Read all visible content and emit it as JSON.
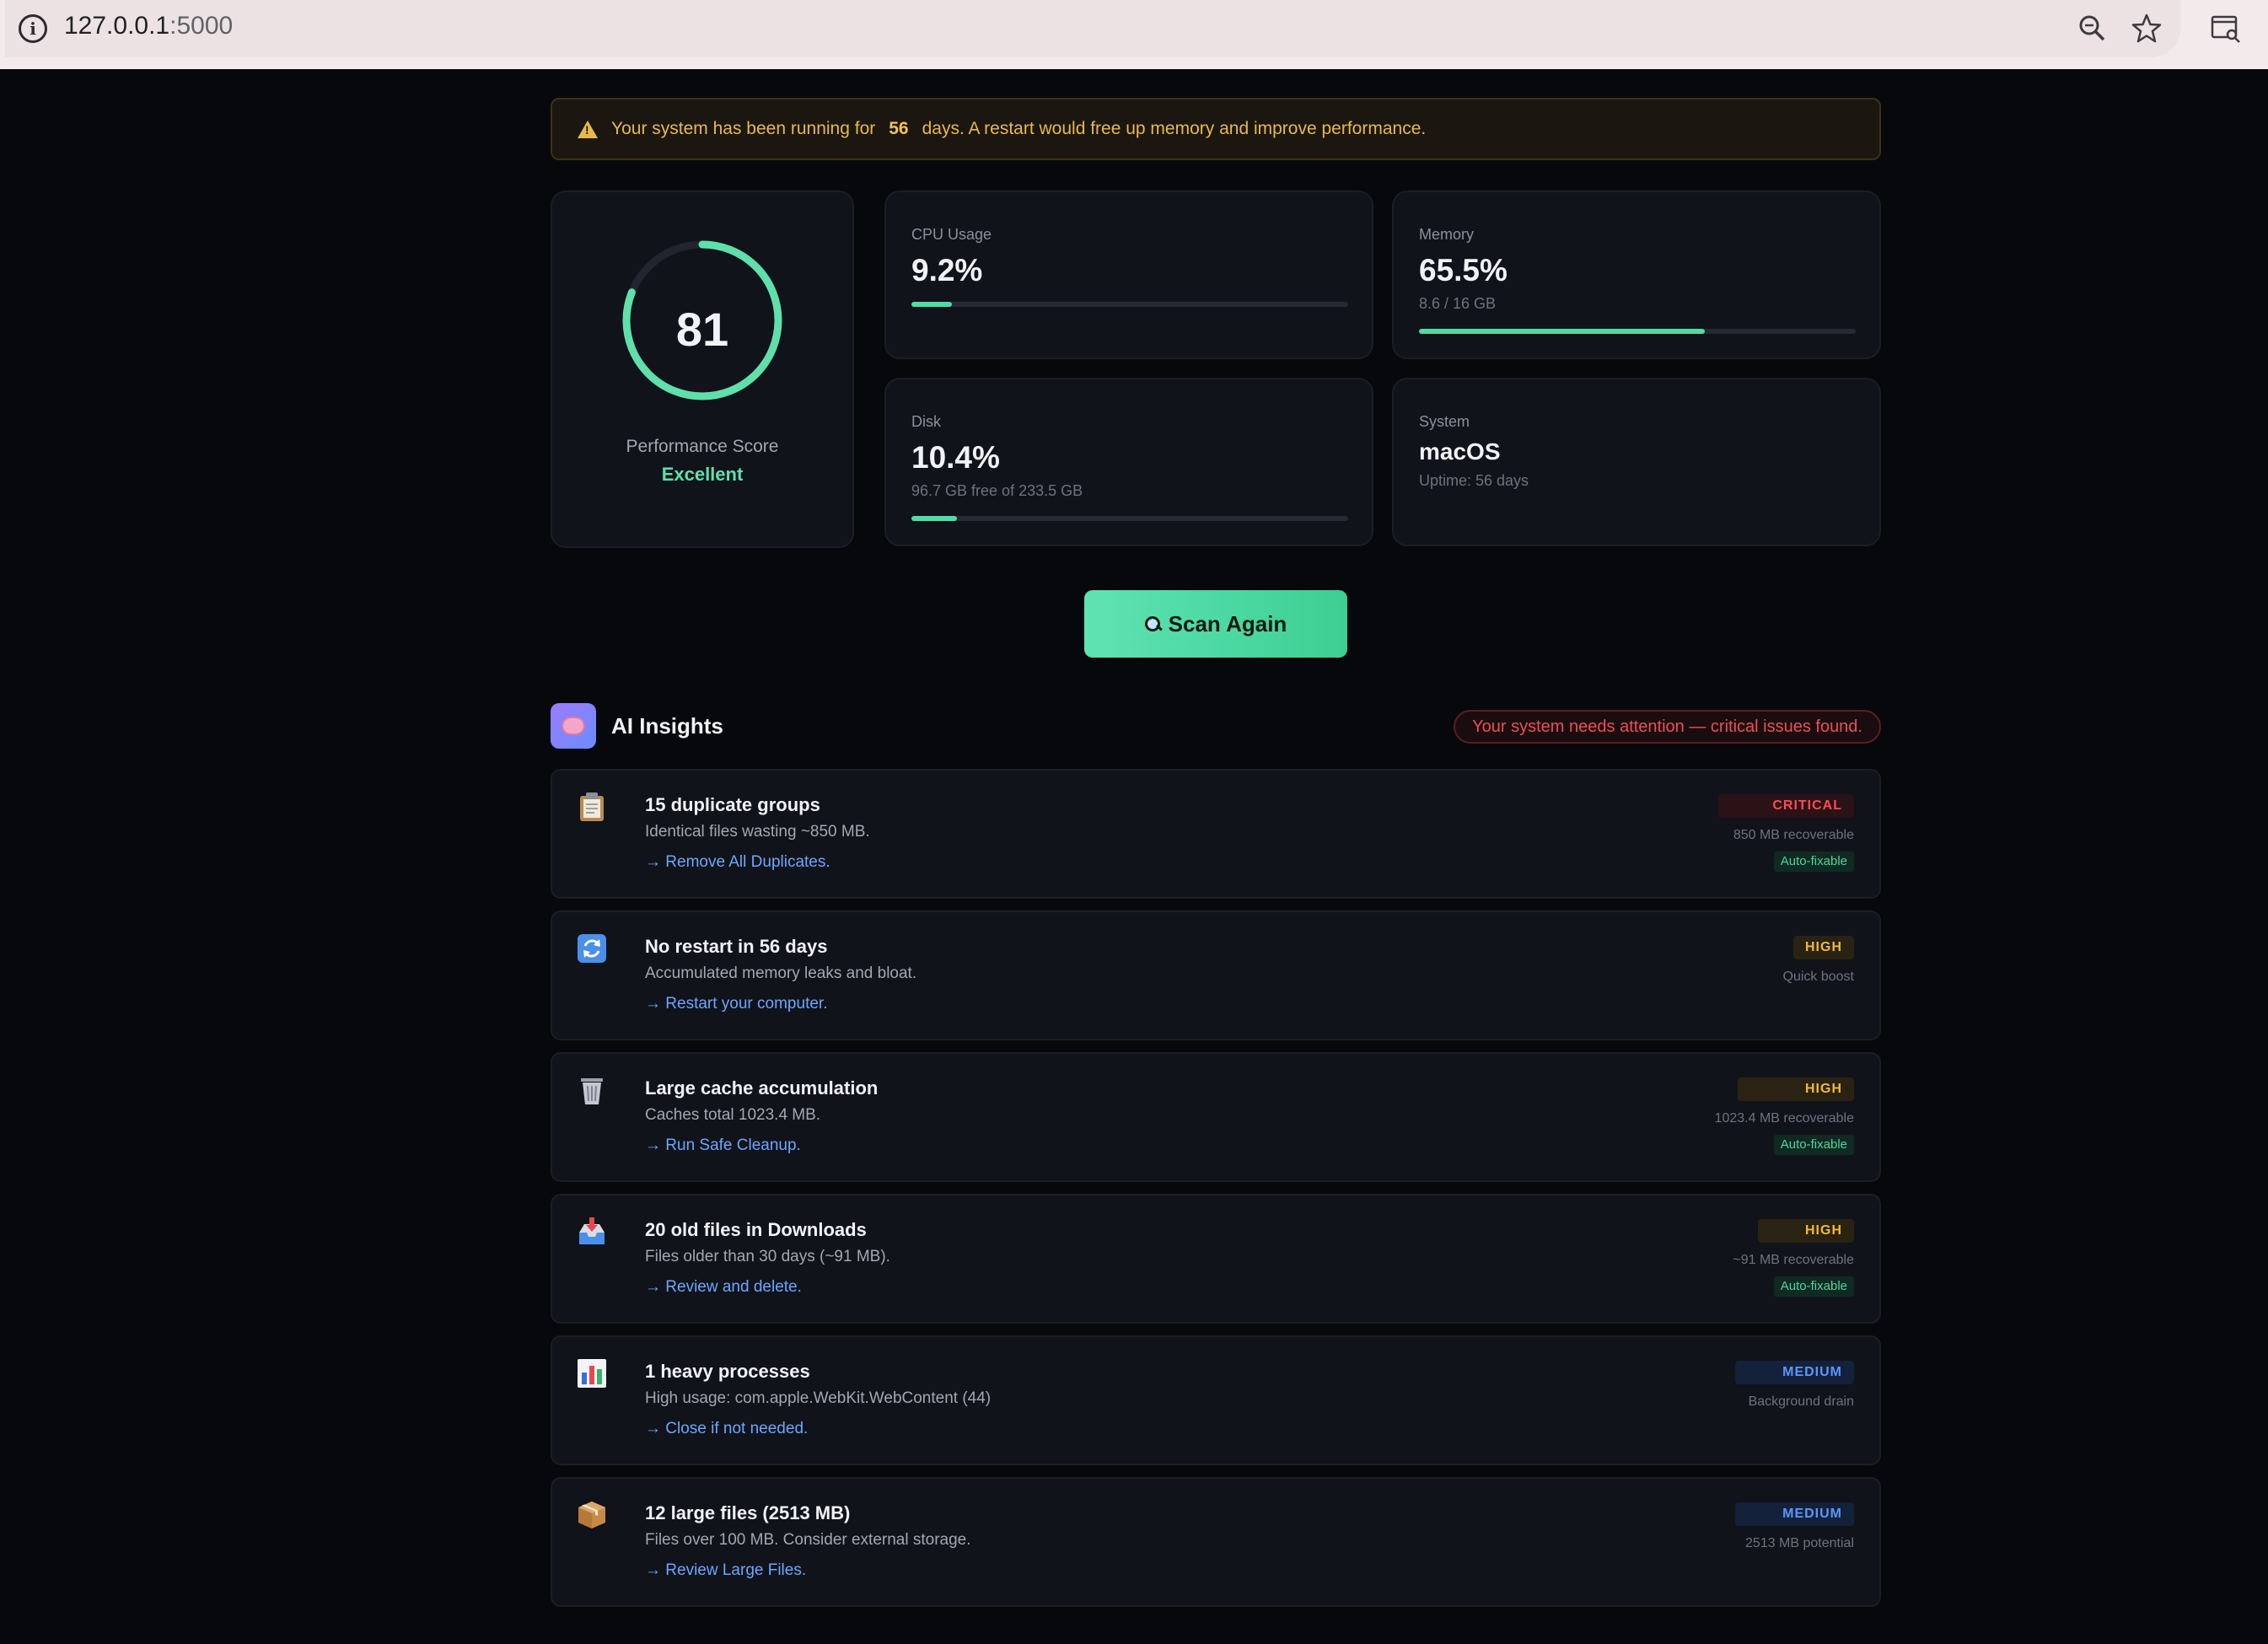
{
  "browser": {
    "url_host": "127.0.0.1",
    "url_port": ":5000"
  },
  "banner": {
    "text_before": "Your system has been running for",
    "days": "56",
    "text_after": "days. A restart would free up memory and improve performance."
  },
  "score": {
    "value": "81",
    "fraction": 0.81,
    "label": "Performance Score",
    "status": "Excellent"
  },
  "cpu": {
    "label": "CPU Usage",
    "value": "9.2%",
    "percent": 9.2
  },
  "memory": {
    "label": "Memory",
    "value": "65.5%",
    "sub": "8.6 / 16 GB",
    "percent": 65.5
  },
  "disk": {
    "label": "Disk",
    "value": "10.4%",
    "sub": "96.7 GB free of 233.5 GB",
    "percent": 10.4
  },
  "system": {
    "label": "System",
    "value": "macOS",
    "sub": "Uptime: 56 days"
  },
  "scan_button": {
    "label": "Scan Again"
  },
  "insights": {
    "title": "AI Insights",
    "attention": "Your system needs attention — critical issues found.",
    "items": [
      {
        "icon": "clipboard-icon",
        "title": "15 duplicate groups",
        "desc": "Identical files wasting ~850 MB.",
        "action": "→ Remove All Duplicates.",
        "severity": "CRITICAL",
        "meta": "850 MB recoverable",
        "auto": "Auto-fixable"
      },
      {
        "icon": "restart-icon",
        "title": "No restart in 56 days",
        "desc": "Accumulated memory leaks and bloat.",
        "action": "→ Restart your computer.",
        "severity": "HIGH",
        "meta": "Quick boost",
        "auto": ""
      },
      {
        "icon": "trash-icon",
        "title": "Large cache accumulation",
        "desc": "Caches total 1023.4 MB.",
        "action": "→ Run Safe Cleanup.",
        "severity": "HIGH",
        "meta": "1023.4 MB recoverable",
        "auto": "Auto-fixable"
      },
      {
        "icon": "inbox-icon",
        "title": "20 old files in Downloads",
        "desc": "Files older than 30 days (~91 MB).",
        "action": "→ Review and delete.",
        "severity": "HIGH",
        "meta": "~91 MB recoverable",
        "auto": "Auto-fixable"
      },
      {
        "icon": "bar-chart-icon",
        "title": "1 heavy processes",
        "desc": "High usage: com.apple.WebKit.WebContent (44)",
        "action": "→ Close if not needed.",
        "severity": "MEDIUM",
        "meta": "Background drain",
        "auto": ""
      },
      {
        "icon": "package-icon",
        "title": "12 large files (2513 MB)",
        "desc": "Files over 100 MB. Consider external storage.",
        "action": "→ Review Large Files.",
        "severity": "MEDIUM",
        "meta": "2513 MB potential",
        "auto": ""
      }
    ]
  },
  "colors": {
    "accent": "#51dca5",
    "critical": "#ff4a52",
    "high": "#f1b93a",
    "medium": "#5b96ff",
    "link": "#6aa7ff"
  }
}
